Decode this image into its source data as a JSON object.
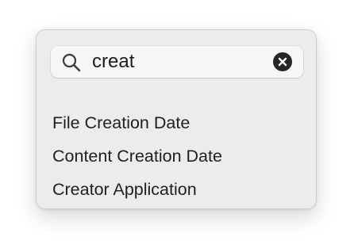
{
  "search": {
    "value": "creat",
    "icon": "magnifying-glass-icon",
    "clear_icon": "clear-circle-x-icon"
  },
  "results": [
    {
      "label": "File Creation Date"
    },
    {
      "label": "Content Creation Date"
    },
    {
      "label": "Creator Application"
    }
  ],
  "colors": {
    "popover_background": "#ececec",
    "field_background": "#f6f6f6",
    "text": "#1f1f1f",
    "clear_button": "#262626"
  }
}
